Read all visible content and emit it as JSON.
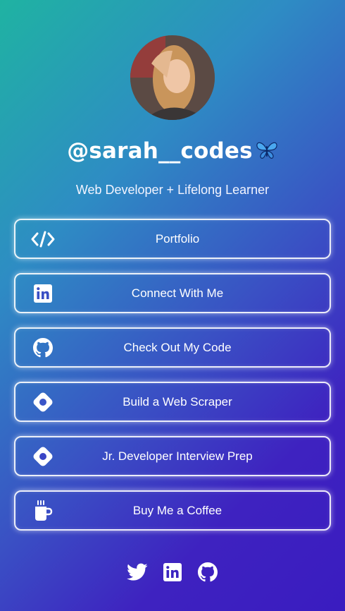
{
  "profile": {
    "handle": "@sarah__codes",
    "tagline": "Web Developer + Lifelong Learner"
  },
  "links": [
    {
      "label": "Portfolio",
      "icon": "code-icon"
    },
    {
      "label": "Connect With Me",
      "icon": "linkedin-icon"
    },
    {
      "label": "Check Out My Code",
      "icon": "github-icon"
    },
    {
      "label": "Build a Web Scraper",
      "icon": "diamond-icon"
    },
    {
      "label": "Jr. Developer Interview Prep",
      "icon": "diamond-icon"
    },
    {
      "label": "Buy Me a Coffee",
      "icon": "coffee-icon"
    }
  ],
  "social": [
    {
      "icon": "twitter-icon"
    },
    {
      "icon": "linkedin-icon"
    },
    {
      "icon": "github-icon"
    }
  ],
  "colors": {
    "gradient_start": "#1fb3a2",
    "gradient_end": "#3a1cc0",
    "button_border": "#ffffff"
  }
}
